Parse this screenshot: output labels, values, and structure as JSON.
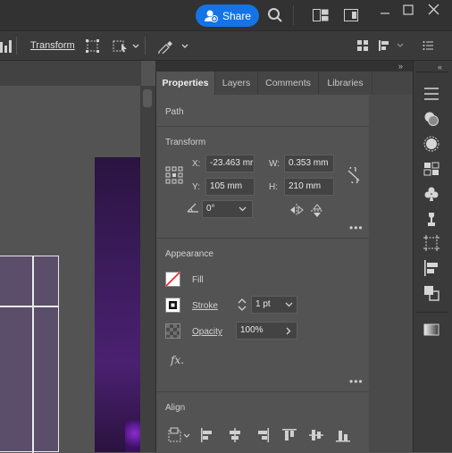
{
  "titlebar": {
    "share_label": "Share"
  },
  "controlbar": {
    "transform_label": "Transform"
  },
  "panel": {
    "tabs": [
      "Properties",
      "Layers",
      "Comments",
      "Libraries"
    ],
    "sections": {
      "path": "Path",
      "transform": "Transform",
      "appearance": "Appearance",
      "align": "Align"
    },
    "transform": {
      "x_label": "X:",
      "x_value": "-23.463 mr",
      "y_label": "Y:",
      "y_value": "105 mm",
      "w_label": "W:",
      "w_value": "0.353 mm",
      "h_label": "H:",
      "h_value": "210 mm",
      "rotate_value": "0°"
    },
    "appearance": {
      "fill_label": "Fill",
      "stroke_label": "Stroke",
      "stroke_value": "1 pt",
      "opacity_label": "Opacity",
      "opacity_value": "100%",
      "fx_label": "fx."
    }
  },
  "colors": {
    "accent": "#1473e6",
    "panel_bg": "#535353",
    "titlebar_bg": "#323232",
    "fill_none_red": "#e03030"
  }
}
